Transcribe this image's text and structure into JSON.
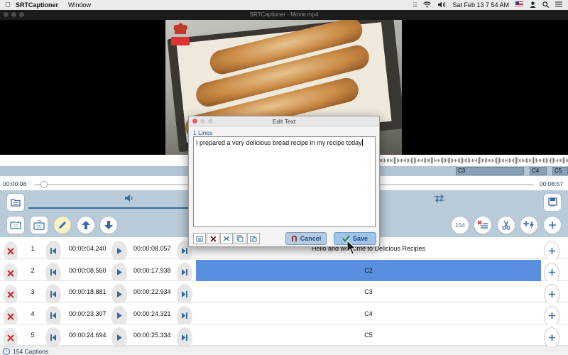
{
  "menubar": {
    "app_name": "SRTCaptioner",
    "menu_window": "Window",
    "clock": "Sat Feb 13  7 54 AM"
  },
  "window": {
    "title": "SRTCaptioner - Movie.mp4"
  },
  "waveform": {
    "caption_blocks": [
      "C3",
      "C4",
      "C5"
    ]
  },
  "timeline": {
    "current_time": "00:00:08",
    "total_time": "00:08:57"
  },
  "toolbar": {
    "caption_count_badge": "154"
  },
  "captions": [
    {
      "index": "1",
      "start": "00:00:04.240",
      "end": "00:00:08.057",
      "text": "Hello and welcome to Delicious Recipes"
    },
    {
      "index": "2",
      "start": "00:00:08.560",
      "end": "00:00:17.938",
      "text": "C2"
    },
    {
      "index": "3",
      "start": "00:00:18.881",
      "end": "00:00:22.934",
      "text": "C3"
    },
    {
      "index": "4",
      "start": "00:00:23.307",
      "end": "00:00:24.321",
      "text": "C4"
    },
    {
      "index": "5",
      "start": "00:00:24.694",
      "end": "00:00:25.334",
      "text": "C5"
    }
  ],
  "selected_row": 1,
  "status": {
    "text": "154 Captions"
  },
  "dialog": {
    "title": "Edit Text",
    "line_count": "1 Lines",
    "text": "I prepared a very delicious bread recipe in my recipe today",
    "cancel_label": "Cancel",
    "save_label": "Save"
  },
  "colors": {
    "accent": "#3b6aa0",
    "delete_red": "#e0212b",
    "selection": "#5a8fe0"
  }
}
